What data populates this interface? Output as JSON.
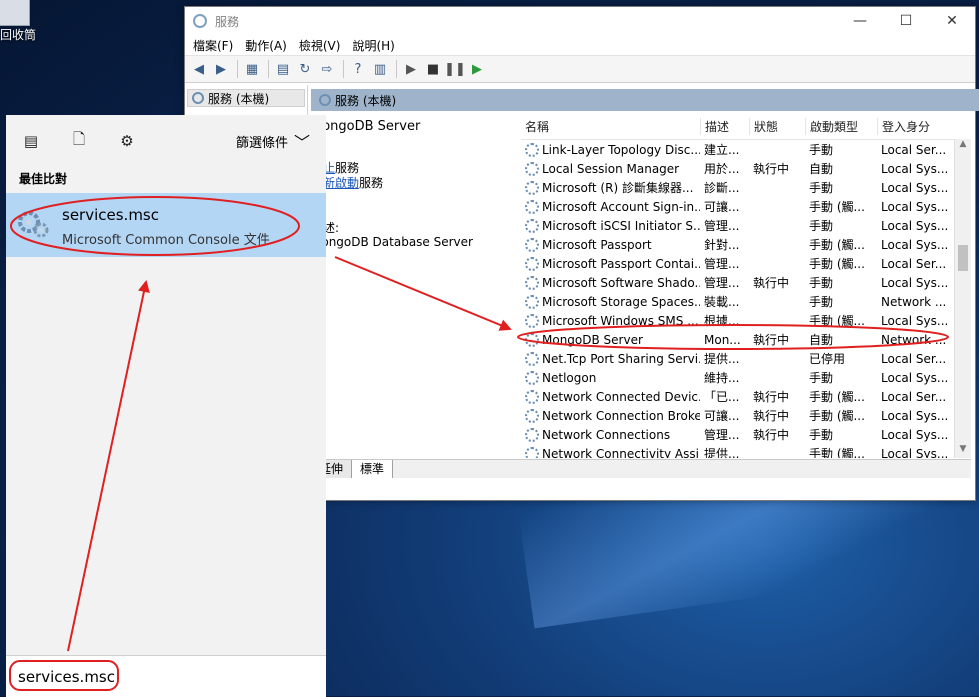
{
  "desktop": {
    "recycle_label": "回收筒"
  },
  "window": {
    "title": "服務",
    "menu": [
      "檔案(F)",
      "動作(A)",
      "檢視(V)",
      "說明(H)"
    ],
    "tree_root": "服務 (本機)",
    "main_header": "服務 (本機)",
    "selected_service": "MongoDB Server",
    "link_stop": "停止",
    "link_stop_suffix": "服務",
    "link_restart": "重新啟動",
    "link_restart_suffix": "服務",
    "desc_label": "描述:",
    "desc_text": "MongoDB Database Server",
    "columns": [
      "名稱",
      "描述",
      "狀態",
      "啟動類型",
      "登入身分"
    ],
    "rows": [
      [
        "Link-Layer Topology Disc...",
        "建立...",
        "",
        "手動",
        "Local Ser..."
      ],
      [
        "Local Session Manager",
        "用於...",
        "執行中",
        "自動",
        "Local Sys..."
      ],
      [
        "Microsoft (R) 診斷集線器...",
        "診斷...",
        "",
        "手動",
        "Local Sys..."
      ],
      [
        "Microsoft Account Sign-in...",
        "可讓...",
        "",
        "手動 (觸...",
        "Local Sys..."
      ],
      [
        "Microsoft iSCSI Initiator S...",
        "管理...",
        "",
        "手動",
        "Local Sys..."
      ],
      [
        "Microsoft Passport",
        "針對...",
        "",
        "手動 (觸...",
        "Local Sys..."
      ],
      [
        "Microsoft Passport Contai...",
        "管理...",
        "",
        "手動 (觸...",
        "Local Ser..."
      ],
      [
        "Microsoft Software Shado...",
        "管理...",
        "執行中",
        "手動",
        "Local Sys..."
      ],
      [
        "Microsoft Storage Spaces...",
        "裝載...",
        "",
        "手動",
        "Network ..."
      ],
      [
        "Microsoft Windows SMS ...",
        "根據...",
        "",
        "手動 (觸...",
        "Local Sys..."
      ],
      [
        "MongoDB Server",
        "Mon...",
        "執行中",
        "自動",
        "Network ..."
      ],
      [
        "Net.Tcp Port Sharing Servi...",
        "提供...",
        "",
        "已停用",
        "Local Ser..."
      ],
      [
        "Netlogon",
        "維持...",
        "",
        "手動",
        "Local Sys..."
      ],
      [
        "Network Connected Devic...",
        "「已...",
        "執行中",
        "手動 (觸...",
        "Local Ser..."
      ],
      [
        "Network Connection Broker",
        "可讓...",
        "執行中",
        "手動 (觸...",
        "Local Sys..."
      ],
      [
        "Network Connections",
        "管理...",
        "執行中",
        "手動",
        "Local Sys..."
      ],
      [
        "Network Connectivity Assi...",
        "提供...",
        "",
        "手動 (觸...",
        "Local Sys..."
      ]
    ],
    "tabs": [
      "延伸",
      "標準"
    ]
  },
  "start": {
    "filter_label": "篩選條件",
    "section_label": "最佳比對",
    "best_title": "services.msc",
    "best_subtitle": "Microsoft Common Console 文件",
    "search_value": "services.msc"
  },
  "colors": {
    "highlight": "#b3d6f5",
    "annotation": "#e02020",
    "header": "#9fb4cb"
  }
}
